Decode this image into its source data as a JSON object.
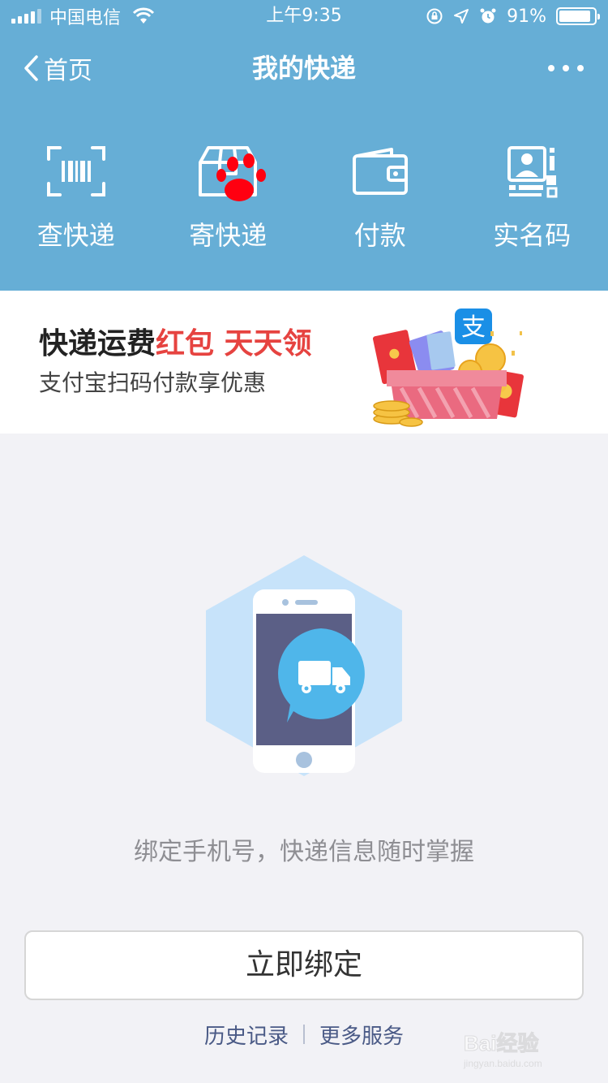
{
  "status_bar": {
    "carrier": "中国电信",
    "time": "上午9:35",
    "battery_percent": "91%",
    "battery_level": 0.91
  },
  "nav": {
    "back_label": "首页",
    "title": "我的快递"
  },
  "actions": [
    {
      "label": "查快递",
      "icon": "barcode-scan-icon"
    },
    {
      "label": "寄快递",
      "icon": "package-box-icon"
    },
    {
      "label": "付款",
      "icon": "wallet-icon"
    },
    {
      "label": "实名码",
      "icon": "id-qrcode-icon"
    }
  ],
  "banner": {
    "title_part1": "快递运费",
    "title_part2": "红包 天天领",
    "subtitle": "支付宝扫码付款享优惠",
    "badge_char": "支"
  },
  "empty_state": {
    "message": "绑定手机号，快递信息随时掌握"
  },
  "bind_button": "立即绑定",
  "footer": {
    "history": "历史记录",
    "more": "更多服务"
  },
  "watermark": {
    "text": "Bai经验",
    "url_text": "jingyan.baidu.com"
  },
  "colors": {
    "header": "#66aed6",
    "accent_red": "#e64340",
    "link": "#4a5a86"
  }
}
